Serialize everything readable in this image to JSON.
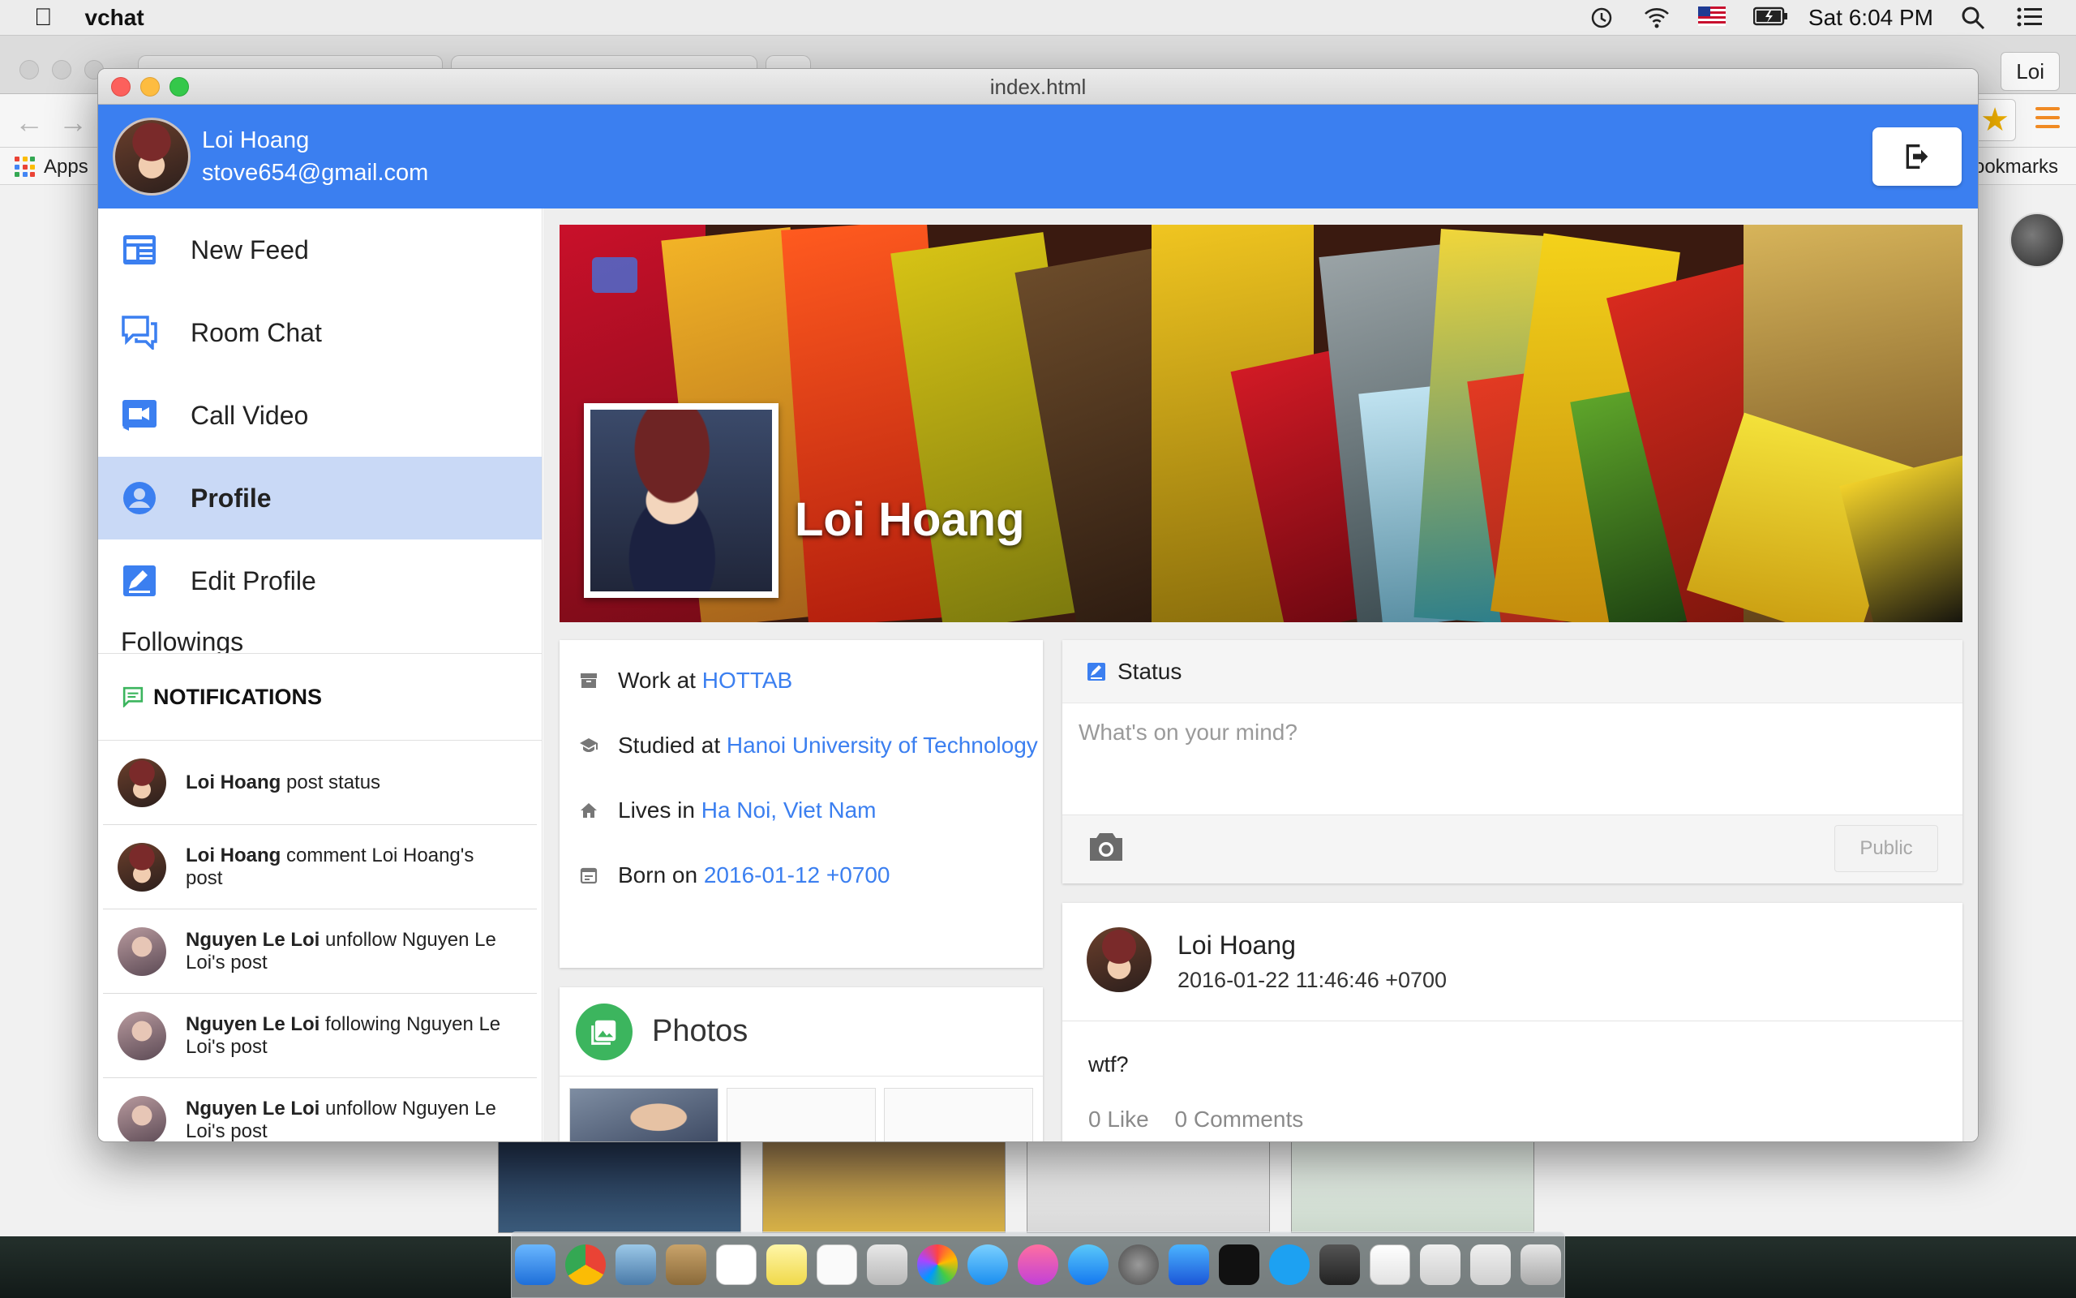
{
  "menubar": {
    "app_name": "vchat",
    "clock": "Sat 6:04 PM"
  },
  "browser": {
    "user_button": "Loi",
    "apps_label": "Apps",
    "bookmarks_label": "ookmarks"
  },
  "window": {
    "title": "index.html"
  },
  "user": {
    "name": "Loi Hoang",
    "email": "stove654@gmail.com"
  },
  "nav": {
    "items": [
      {
        "label": "New Feed",
        "icon": "newspaper-icon"
      },
      {
        "label": "Room Chat",
        "icon": "chat-icon"
      },
      {
        "label": "Call Video",
        "icon": "video-camera-icon"
      },
      {
        "label": "Profile",
        "icon": "account-circle-icon",
        "active": true
      },
      {
        "label": "Edit Profile",
        "icon": "edit-icon"
      }
    ],
    "partial_item": "Followings"
  },
  "notifications": {
    "title": "NOTIFICATIONS",
    "items": [
      {
        "actor": "Loi Hoang",
        "action": " post status"
      },
      {
        "actor": "Loi Hoang",
        "action": " comment Loi Hoang's post"
      },
      {
        "actor": "Nguyen Le Loi",
        "action": " unfollow Nguyen Le Loi's post"
      },
      {
        "actor": "Nguyen Le Loi",
        "action": " following Nguyen Le Loi's post"
      },
      {
        "actor": "Nguyen Le Loi",
        "action": " unfollow Nguyen Le Loi's post"
      }
    ]
  },
  "profile": {
    "cover_name": "Loi Hoang",
    "work_prefix": "Work at ",
    "work_value": "HOTTAB",
    "study_prefix": "Studied at ",
    "study_value": "Hanoi University of Technology",
    "lives_prefix": "Lives in ",
    "lives_value": "Ha Noi, Viet Nam",
    "born_prefix": "Born on ",
    "born_value": "2016-01-12 +0700"
  },
  "photos": {
    "title": "Photos"
  },
  "status": {
    "title": "Status",
    "placeholder": "What's on your mind?",
    "public_label": "Public"
  },
  "post": {
    "author": "Loi Hoang",
    "time": "2016-01-22 11:46:46 +0700",
    "body": "wtf?",
    "likes": "0 Like",
    "comments": "0 Comments"
  },
  "colors": {
    "primary": "#3b7ff0",
    "active_nav": "#c9d9f6",
    "photos_accent": "#3cb55e"
  }
}
